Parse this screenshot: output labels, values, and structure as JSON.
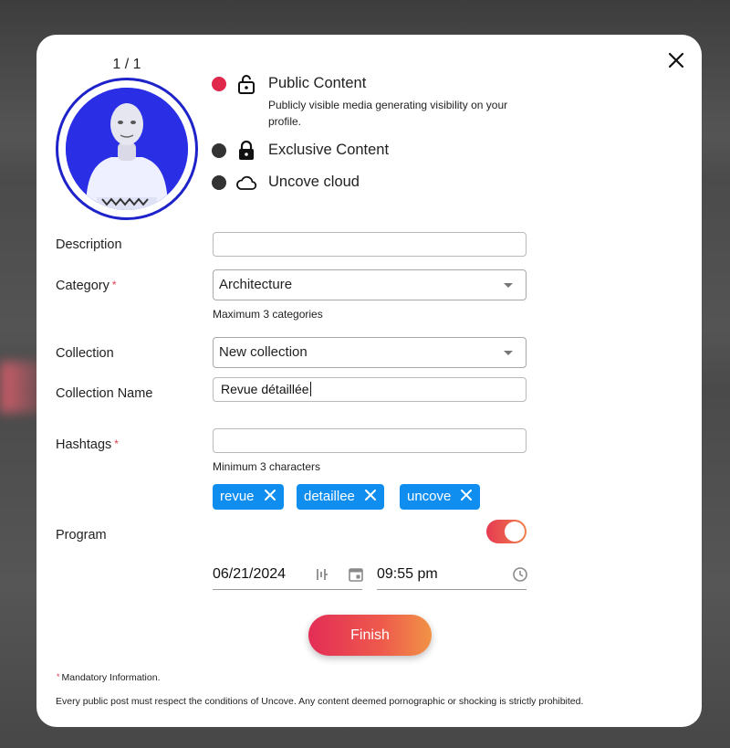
{
  "media": {
    "counter": "1 / 1"
  },
  "visibility": {
    "options": [
      {
        "label": "Public Content",
        "selected": true,
        "dot_color": "#e0294a",
        "icon": "unlocked-padlock-icon"
      },
      {
        "label": "Exclusive Content",
        "selected": false,
        "dot_color": "#333333",
        "icon": "locked-padlock-icon"
      },
      {
        "label": "Uncove cloud",
        "selected": false,
        "dot_color": "#333333",
        "icon": "cloud-icon"
      }
    ],
    "public_description": "Publicly visible media generating visibility on your profile."
  },
  "form": {
    "description": {
      "label": "Description",
      "value": ""
    },
    "category": {
      "label": "Category",
      "value": "Architecture",
      "hint": "Maximum 3 categories",
      "required": "*"
    },
    "collection": {
      "label": "Collection",
      "value": "New collection"
    },
    "collection_name": {
      "label": "Collection Name",
      "value": "Revue détaillée"
    },
    "hashtags": {
      "label": "Hashtags",
      "required": "*",
      "value": "",
      "hint": "Minimum 3 characters",
      "tags": [
        "revue",
        "detaillee",
        "uncove"
      ]
    },
    "program": {
      "label": "Program",
      "enabled": true
    },
    "date": "06/21/2024",
    "time": "09:55 pm"
  },
  "actions": {
    "finish_label": "Finish"
  },
  "footer": {
    "mandatory_marker": "*",
    "mandatory_note": "Mandatory Information.",
    "policy_note": "Every public post must respect the conditions of Uncove. Any content deemed pornographic or shocking is strictly prohibited."
  },
  "colors": {
    "accent_gradient_start": "#e32d56",
    "accent_gradient_end": "#f19346",
    "chip_blue": "#0f8ef0",
    "avatar_ring": "#1d22c9",
    "required_red": "#e23a4f"
  }
}
